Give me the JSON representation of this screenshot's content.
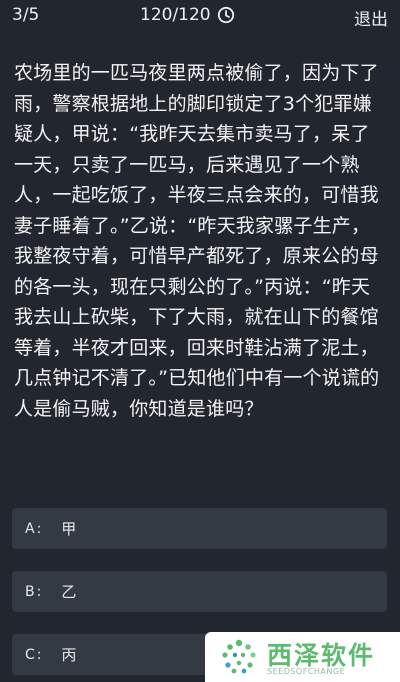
{
  "header": {
    "progress": "3/5",
    "timer": "120/120",
    "timer_icon": "clock-icon",
    "exit_label": "退出"
  },
  "question": {
    "text": "农场里的一匹马夜里两点被偷了，因为下了雨，警察根据地上的脚印锁定了3个犯罪嫌疑人，甲说：“我昨天去集市卖马了，呆了一天，只卖了一匹马，后来遇见了一个熟人，一起吃饭了，半夜三点会来的，可惜我妻子睡着了。”乙说：“昨天我家骡子生产，我整夜守着，可惜早产都死了，原来公的母的各一头，现在只剩公的了。”丙说：“昨天我去山上砍柴，下了大雨，就在山下的餐馆等着，半夜才回来，回来时鞋沾满了泥土，几点钟记不清了。”已知他们中有一个说谎的人是偷马贼，你知道是谁吗？"
  },
  "options": [
    {
      "letter": "A",
      "sep": ":",
      "text": "甲"
    },
    {
      "letter": "B",
      "sep": ":",
      "text": "乙"
    },
    {
      "letter": "C",
      "sep": ":",
      "text": "丙"
    }
  ],
  "watermark": {
    "title": "西泽软件",
    "subtitle": "SEEDSOFCHANGE",
    "logo_icon": "dots-logo-icon",
    "accent": "#5dbb6f"
  },
  "colors": {
    "background": "#21262f",
    "option_background": "#343a43",
    "text": "#f3f3f3"
  }
}
